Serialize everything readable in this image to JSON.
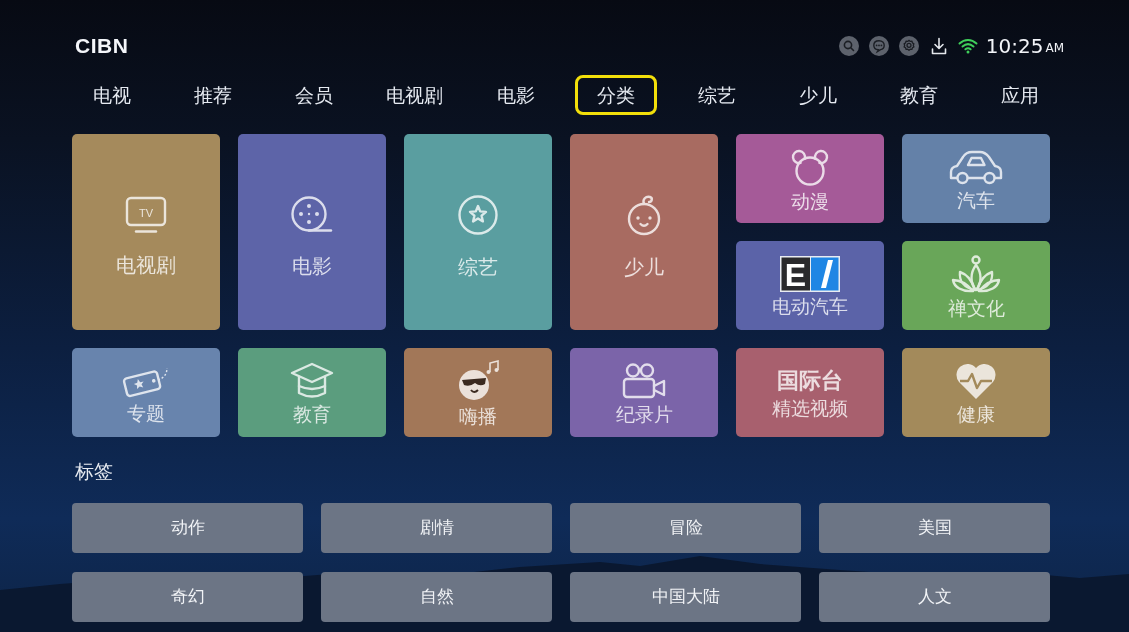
{
  "header": {
    "logo": "CIBN",
    "time": "10:25",
    "meridiem": "AM"
  },
  "tabs": [
    {
      "label": "电视",
      "selected": false
    },
    {
      "label": "推荐",
      "selected": false
    },
    {
      "label": "会员",
      "selected": false
    },
    {
      "label": "电视剧",
      "selected": false
    },
    {
      "label": "电影",
      "selected": false
    },
    {
      "label": "分类",
      "selected": true
    },
    {
      "label": "综艺",
      "selected": false
    },
    {
      "label": "少儿",
      "selected": false
    },
    {
      "label": "教育",
      "selected": false
    },
    {
      "label": "应用",
      "selected": false
    }
  ],
  "tiles": [
    {
      "kind": "large",
      "label": "电视剧",
      "color": "#a58a5c",
      "icon_text": "TV"
    },
    {
      "kind": "large",
      "label": "电影",
      "color": "#5d64a8"
    },
    {
      "kind": "large",
      "label": "综艺",
      "color": "#5a9ea0"
    },
    {
      "kind": "large",
      "label": "少儿",
      "color": "#a86b61"
    },
    {
      "kind": "small",
      "label": "动漫",
      "color": "#a55a98"
    },
    {
      "kind": "small",
      "label": "汽车",
      "color": "#6481a8"
    },
    {
      "kind": "small",
      "label": "电动汽车",
      "color": "#5b63a8",
      "logo_text": "E"
    },
    {
      "kind": "small",
      "label": "禅文化",
      "color": "#69a659"
    },
    {
      "kind": "small",
      "label": "专题",
      "color": "#6884ad"
    },
    {
      "kind": "small",
      "label": "教育",
      "color": "#5b9d7e"
    },
    {
      "kind": "small",
      "label": "嗨播",
      "color": "#a27758"
    },
    {
      "kind": "small",
      "label": "纪录片",
      "color": "#7b64a9"
    },
    {
      "kind": "small",
      "label": "精选视频",
      "color": "#a8606e",
      "logo_text": "国际台"
    },
    {
      "kind": "small",
      "label": "健康",
      "color": "#a38a5b"
    }
  ],
  "tags_section": {
    "title": "标签",
    "tags": [
      "动作",
      "剧情",
      "冒险",
      "美国",
      "奇幻",
      "自然",
      "中国大陆",
      "人文"
    ]
  }
}
